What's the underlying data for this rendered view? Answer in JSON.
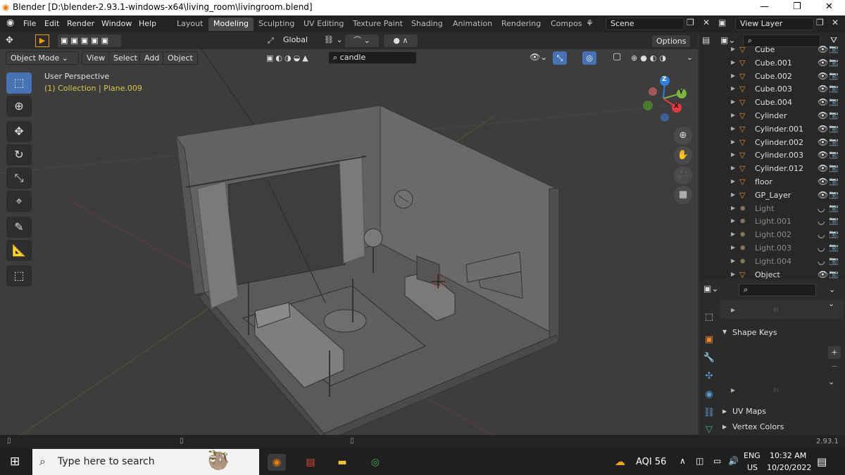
{
  "window": {
    "title": "Blender [D:\\blender-2.93.1-windows-x64\\living_room\\livingroom.blend]"
  },
  "menu": [
    "File",
    "Edit",
    "Render",
    "Window",
    "Help"
  ],
  "workspaces": [
    "Layout",
    "Modeling",
    "Sculpting",
    "UV Editing",
    "Texture Paint",
    "Shading",
    "Animation",
    "Rendering",
    "Compos"
  ],
  "active_workspace": "Modeling",
  "scene": "Scene",
  "view_layer": "View Layer",
  "toolbar": {
    "orientation": "Global",
    "options": "Options"
  },
  "viewport_header": {
    "mode": "Object Mode",
    "view": "View",
    "select": "Select",
    "add": "Add",
    "object": "Object",
    "search_value": "candle"
  },
  "viewport": {
    "perspective": "User Perspective",
    "collection_info": "(1) Collection | Plane.009"
  },
  "gizmo": {
    "z": "Z",
    "y": "Y",
    "x": "X"
  },
  "outliner": {
    "items": [
      {
        "name": "Cube",
        "type": "mesh"
      },
      {
        "name": "Cube.001",
        "type": "mesh"
      },
      {
        "name": "Cube.002",
        "type": "mesh"
      },
      {
        "name": "Cube.003",
        "type": "mesh"
      },
      {
        "name": "Cube.004",
        "type": "mesh"
      },
      {
        "name": "Cylinder",
        "type": "mesh"
      },
      {
        "name": "Cylinder.001",
        "type": "mesh"
      },
      {
        "name": "Cylinder.002",
        "type": "mesh"
      },
      {
        "name": "Cylinder.003",
        "type": "mesh"
      },
      {
        "name": "Cylinder.012",
        "type": "mesh"
      },
      {
        "name": "floor",
        "type": "mesh"
      },
      {
        "name": "GP_Layer",
        "type": "mesh"
      },
      {
        "name": "Light",
        "type": "light"
      },
      {
        "name": "Light.001",
        "type": "light"
      },
      {
        "name": "Light.002",
        "type": "light"
      },
      {
        "name": "Light.003",
        "type": "light"
      },
      {
        "name": "Light.004",
        "type": "light"
      },
      {
        "name": "Object",
        "type": "mesh"
      }
    ]
  },
  "properties": {
    "shape_keys": "Shape Keys",
    "uv_maps": "UV Maps",
    "vertex_colors": "Vertex Colors"
  },
  "status": {
    "version": "2.93.1"
  },
  "taskbar": {
    "search_placeholder": "Type here to search",
    "aqi": "AQI 56",
    "lang": "ENG",
    "region": "US",
    "time": "10:32 AM",
    "date": "10/20/2022"
  },
  "colors": {
    "accent": "#4772b3",
    "active_tab": "#474747",
    "axis_x": "#e0393e",
    "axis_y": "#7cb342",
    "axis_z": "#2e7fe0",
    "collection_text": "#d6c84a"
  }
}
